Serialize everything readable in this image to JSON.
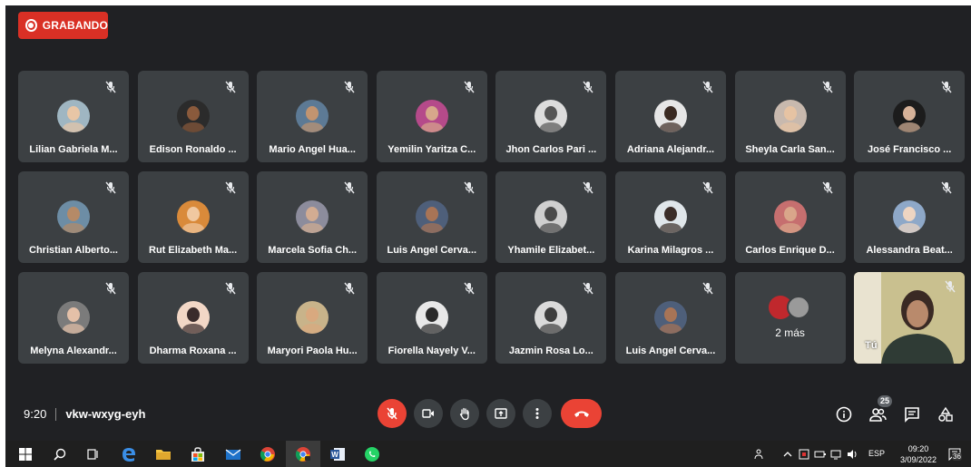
{
  "recording": {
    "label": "GRABANDO",
    "color": "#d93025"
  },
  "participants": [
    {
      "name": "Lilian Gabriela M...",
      "avatar": {
        "bg": "#9fb6c2",
        "face": "#e8c6a6"
      }
    },
    {
      "name": "Edison Ronaldo ...",
      "avatar": {
        "bg": "#2b2b2b",
        "face": "#8a5a3c"
      }
    },
    {
      "name": "Mario Angel Hua...",
      "avatar": {
        "bg": "#5d7a95",
        "face": "#c29470"
      }
    },
    {
      "name": "Yemilin Yaritza C...",
      "avatar": {
        "bg": "#b54a8a",
        "face": "#d7a78b"
      }
    },
    {
      "name": "Jhon Carlos Pari ...",
      "avatar": {
        "bg": "#dcdcdc",
        "face": "#555555"
      }
    },
    {
      "name": "Adriana Alejandr...",
      "avatar": {
        "bg": "#e6e6e6",
        "face": "#3a2a22"
      }
    },
    {
      "name": "Sheyla Carla San...",
      "avatar": {
        "bg": "#c8b9ae",
        "face": "#e6c3a3"
      }
    },
    {
      "name": "José Francisco ...",
      "avatar": {
        "bg": "#1c1c1c",
        "face": "#d6b299"
      }
    },
    {
      "name": "Christian Alberto...",
      "avatar": {
        "bg": "#6d8da5",
        "face": "#b58a67"
      }
    },
    {
      "name": "Rut Elizabeth Ma...",
      "avatar": {
        "bg": "#d98a3a",
        "face": "#f0c8a0"
      }
    },
    {
      "name": "Marcela Sofia Ch...",
      "avatar": {
        "bg": "#8c8c9c",
        "face": "#d2ac92"
      }
    },
    {
      "name": "Luis Angel Cerva...",
      "avatar": {
        "bg": "#4e5f7a",
        "face": "#a87456"
      }
    },
    {
      "name": "Yhamile Elizabet...",
      "avatar": {
        "bg": "#cfcfcf",
        "face": "#4a4a4a"
      }
    },
    {
      "name": "Karina Milagros ...",
      "avatar": {
        "bg": "#e0e6ea",
        "face": "#3b2d28"
      }
    },
    {
      "name": "Carlos Enrique D...",
      "avatar": {
        "bg": "#c66f6f",
        "face": "#d9a68a"
      }
    },
    {
      "name": "Alessandra Beat...",
      "avatar": {
        "bg": "#8ea8c8",
        "face": "#eed5c2"
      }
    },
    {
      "name": "Melyna Alexandr...",
      "avatar": {
        "bg": "#7b7b7b",
        "face": "#e4c0a8"
      }
    },
    {
      "name": "Dharma Roxana ...",
      "avatar": {
        "bg": "#f2d7c6",
        "face": "#3a2b2b"
      }
    },
    {
      "name": "Maryori Paola Hu...",
      "avatar": {
        "bg": "#c8b38a",
        "face": "#d9a97f"
      }
    },
    {
      "name": "Fiorella Nayely V...",
      "avatar": {
        "bg": "#e8e8e8",
        "face": "#2a2a2a"
      }
    },
    {
      "name": "Jazmin Rosa Lo...",
      "avatar": {
        "bg": "#dadada",
        "face": "#3e3e3e"
      }
    },
    {
      "name": "Luis Angel Cerva...",
      "avatar": {
        "bg": "#4e5f7a",
        "face": "#a87456"
      }
    }
  ],
  "more": {
    "label": "2 más"
  },
  "self": {
    "label": "Tú"
  },
  "meeting": {
    "time": "9:20",
    "code": "vkw-wxyg-eyh"
  },
  "people": {
    "count": "25"
  },
  "taskbar": {
    "lang": "ESP",
    "time": "09:20",
    "date": "3/09/2022",
    "notifications": "36"
  },
  "colors": {
    "tile": "#3c4043",
    "background": "#202124",
    "danger": "#ea4335"
  }
}
